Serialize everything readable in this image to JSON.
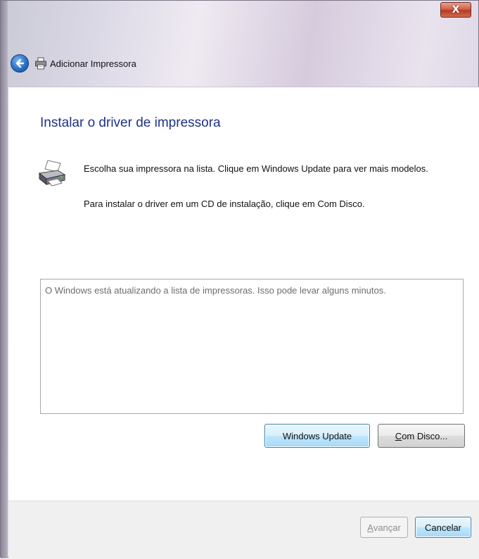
{
  "window": {
    "title": "Adicionar Impressora",
    "close_label": "X"
  },
  "icons": {
    "back": "back-arrow-icon",
    "printer": "printer-icon"
  },
  "content": {
    "heading": "Instalar o driver de impressora",
    "instruction_1": "Escolha sua impressora na lista. Clique em Windows Update para ver mais modelos.",
    "instruction_2": "Para instalar o driver em um CD de instalação, clique em Com Disco.",
    "list_status": "O Windows está atualizando a lista de impressoras. Isso pode levar alguns minutos."
  },
  "buttons": {
    "windows_update": "Windows Update",
    "have_disk_accel": "C",
    "have_disk_rest": "om Disco...",
    "next_accel": "A",
    "next_rest": "vançar",
    "cancel": "Cancelar"
  },
  "colors": {
    "heading": "#1e3287",
    "default_button_border": "#3c7fb1",
    "close_button": "#c4482e"
  }
}
